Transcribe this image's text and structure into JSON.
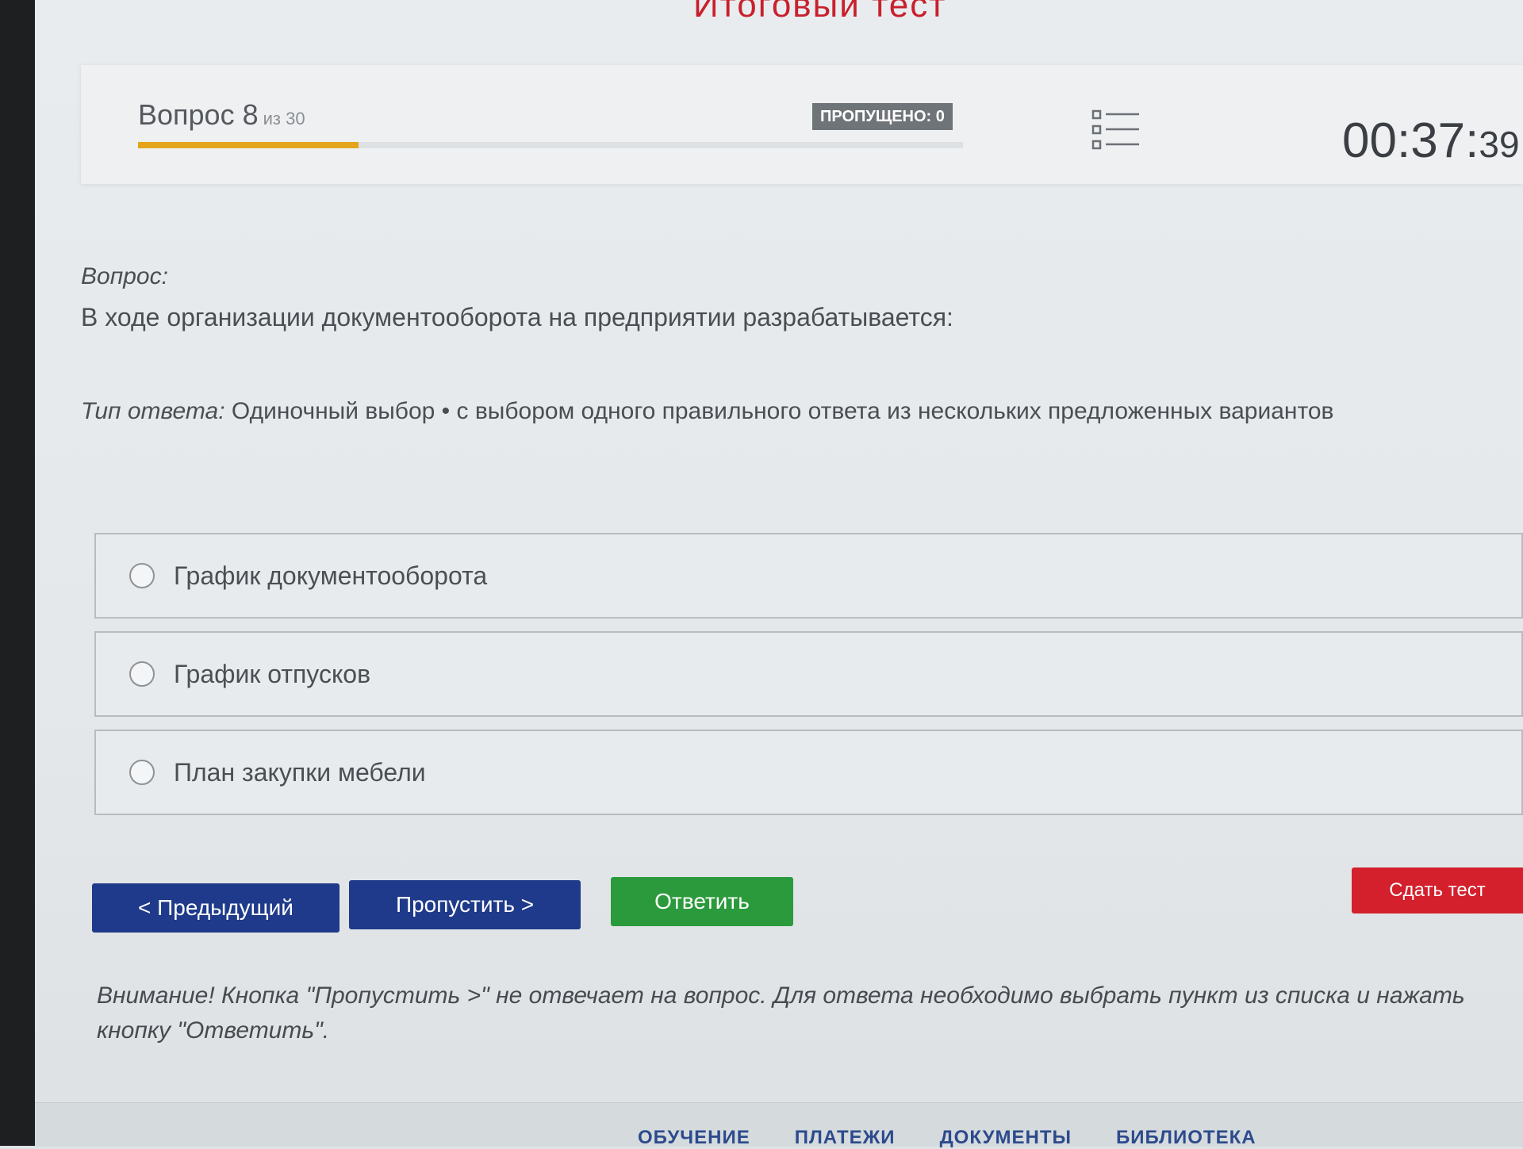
{
  "header": {
    "title": "Итоговый тест"
  },
  "progress": {
    "question_label": "Вопрос 8",
    "of_label": "из 30",
    "fraction": 0.267,
    "skipped_label": "ПРОПУЩЕНО: 0",
    "timer_main": "00:37:",
    "timer_seconds": "39"
  },
  "question": {
    "label": "Вопрос:",
    "text": "В ходе организации документооборота на предприятии разрабатывается:",
    "answer_type_label": "Тип ответа:",
    "answer_type_value": "Одиночный выбор • с выбором одного правильного ответа из нескольких предложенных вариантов"
  },
  "options": [
    {
      "label": "График документооборота"
    },
    {
      "label": "График отпусков"
    },
    {
      "label": "План закупки мебели"
    }
  ],
  "buttons": {
    "prev": "< Предыдущий",
    "skip": "Пропустить >",
    "answer": "Ответить",
    "submit": "Сдать тест"
  },
  "warning": "Внимание! Кнопка \"Пропустить >\" не отвечает на вопрос. Для ответа необходимо выбрать пункт из списка и нажать кнопку \"Ответить\".",
  "footer": {
    "items": [
      "ОБУЧЕНИЕ",
      "ПЛАТЕЖИ",
      "ДОКУМЕНТЫ",
      "БИБЛИОТЕКА"
    ]
  },
  "colors": {
    "accent_red": "#c8202d",
    "progress_yellow": "#e3a51b",
    "primary_blue": "#1f3a8a",
    "success_green": "#2b9a3c",
    "danger_red": "#d3202c"
  }
}
